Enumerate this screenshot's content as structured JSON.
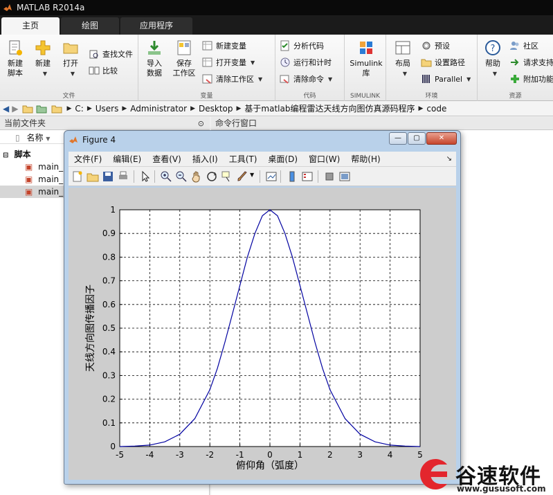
{
  "app": {
    "title": "MATLAB R2014a"
  },
  "tabs": [
    "主页",
    "绘图",
    "应用程序"
  ],
  "ribbon": {
    "file": {
      "label": "文件",
      "new_script": [
        "新建",
        "脚本"
      ],
      "new": "新建",
      "open": "打开",
      "find_files": "查找文件",
      "compare": "比较"
    },
    "variable": {
      "label": "变量",
      "import": [
        "导入",
        "数据"
      ],
      "save": [
        "保存",
        "工作区"
      ],
      "new_var": "新建变量",
      "open_var": "打开变量",
      "clear_ws": "清除工作区"
    },
    "code": {
      "label": "代码",
      "analyze": "分析代码",
      "run_time": "运行和计时",
      "clear_cmd": "清除命令"
    },
    "simulink": {
      "label": "SIMULINK",
      "btn": [
        "Simulink",
        "库"
      ]
    },
    "env": {
      "label": "环境",
      "layout": "布局",
      "prefs": "预设",
      "set_path": "设置路径",
      "parallel": "Parallel"
    },
    "res": {
      "label": "资源",
      "help": "帮助",
      "community": "社区",
      "support": "请求支持",
      "addons": "附加功能"
    }
  },
  "address": {
    "crumbs": [
      "C:",
      "Users",
      "Administrator",
      "Desktop",
      "基于matlab编程雷达天线方向图仿真源码程序",
      "code"
    ]
  },
  "panels": {
    "current_folder": "当前文件夹",
    "command_window": "命令行窗口",
    "name_col": "名称",
    "group": "脚本",
    "files": [
      "main_",
      "main_",
      "main_"
    ]
  },
  "figure": {
    "title": "Figure 4",
    "menu": [
      "文件(F)",
      "编辑(E)",
      "查看(V)",
      "插入(I)",
      "工具(T)",
      "桌面(D)",
      "窗口(W)",
      "帮助(H)"
    ]
  },
  "chart_data": {
    "type": "line",
    "title": "",
    "xlabel": "俯仰角（弧度）",
    "ylabel": "天线方向图传播因子",
    "xlim": [
      -5,
      5
    ],
    "ylim": [
      0,
      1
    ],
    "xticks": [
      "-5",
      "-4",
      "-3",
      "-2",
      "-1",
      "0",
      "1",
      "2",
      "3",
      "4",
      "5"
    ],
    "yticks": [
      "0",
      "0.1",
      "0.2",
      "0.3",
      "0.4",
      "0.5",
      "0.6",
      "0.7",
      "0.8",
      "0.9",
      "1"
    ],
    "grid": true,
    "series": [
      {
        "color": "#0000a0",
        "x": [
          -5,
          -4.5,
          -4,
          -3.5,
          -3,
          -2.5,
          -2,
          -1.75,
          -1.5,
          -1.25,
          -1,
          -0.75,
          -0.5,
          -0.25,
          0,
          0.25,
          0.5,
          0.75,
          1,
          1.25,
          1.5,
          1.75,
          2,
          2.5,
          3,
          3.5,
          4,
          4.5,
          5
        ],
        "y": [
          0.0,
          0.002,
          0.006,
          0.02,
          0.052,
          0.118,
          0.24,
          0.33,
          0.44,
          0.56,
          0.68,
          0.8,
          0.9,
          0.975,
          1.0,
          0.975,
          0.9,
          0.8,
          0.68,
          0.56,
          0.44,
          0.33,
          0.24,
          0.118,
          0.052,
          0.02,
          0.006,
          0.002,
          0.0
        ]
      }
    ]
  },
  "watermark": {
    "name": "谷速软件",
    "url": "www.gususoft.com"
  },
  "colors": {
    "accent": "#0072bd",
    "line": "#0000a0",
    "ribbon_bg": "#f0f0f0"
  }
}
